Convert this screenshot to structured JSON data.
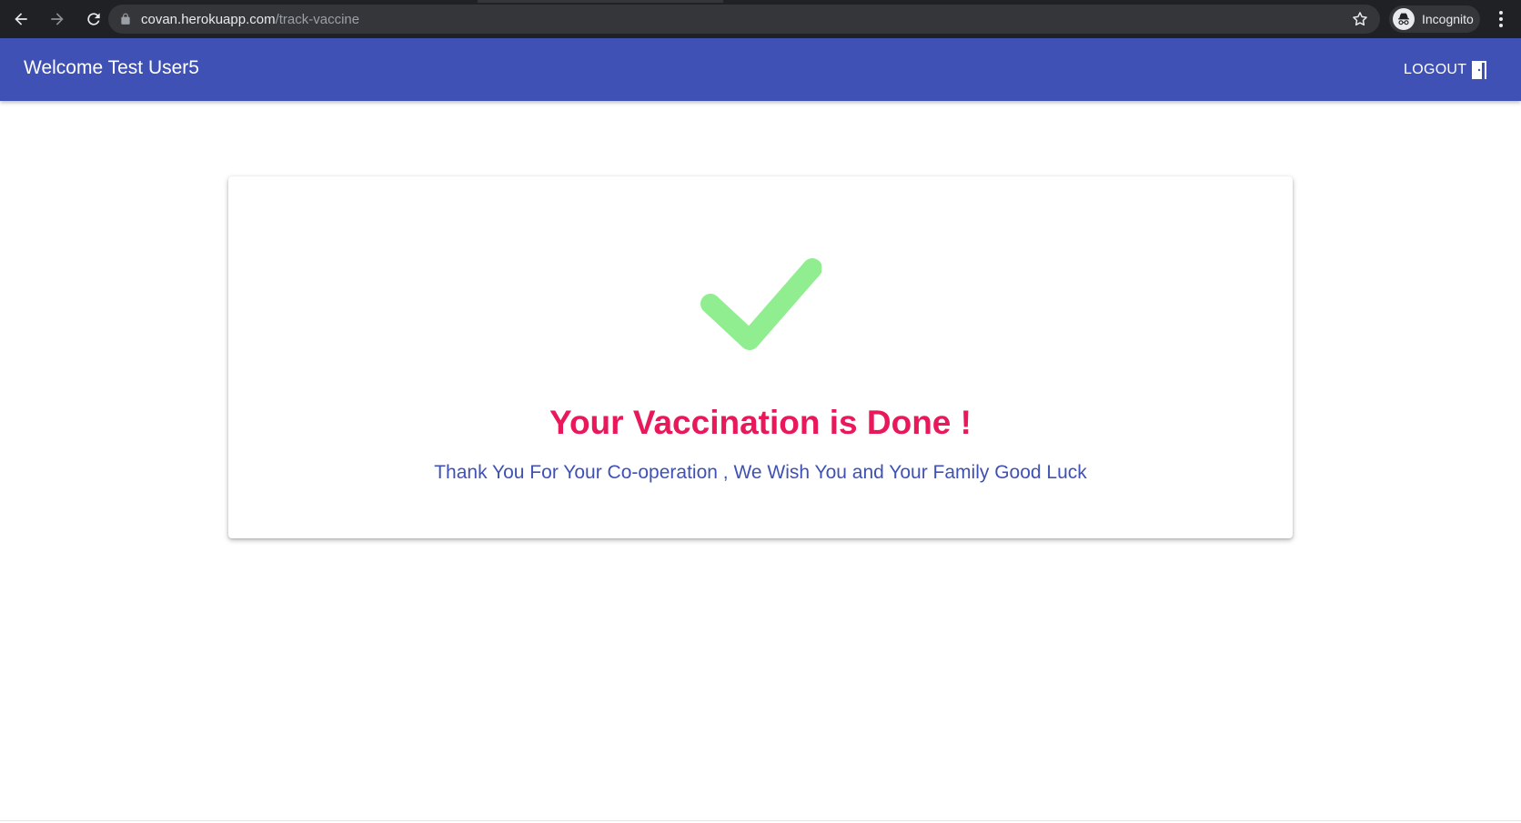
{
  "browser": {
    "url_domain": "covan.herokuapp.com",
    "url_path": "/track-vaccine",
    "profile_label": "Incognito",
    "icons": [
      "back-icon",
      "forward-icon",
      "reload-icon",
      "lock-icon",
      "star-icon",
      "incognito-icon",
      "more-icon"
    ]
  },
  "appbar": {
    "title": "Welcome Test User5",
    "logout_label": "LOGOUT",
    "logout_icon": "door-exit-icon",
    "color": "#3f51b5"
  },
  "card": {
    "icon": "checkmark-icon",
    "icon_color": "#90ee90",
    "headline": "Your Vaccination is Done !",
    "headline_color": "#e8185a",
    "message": "Thank You For Your Co-operation , We Wish You and Your Family Good Luck",
    "message_color": "#3f51b5"
  }
}
